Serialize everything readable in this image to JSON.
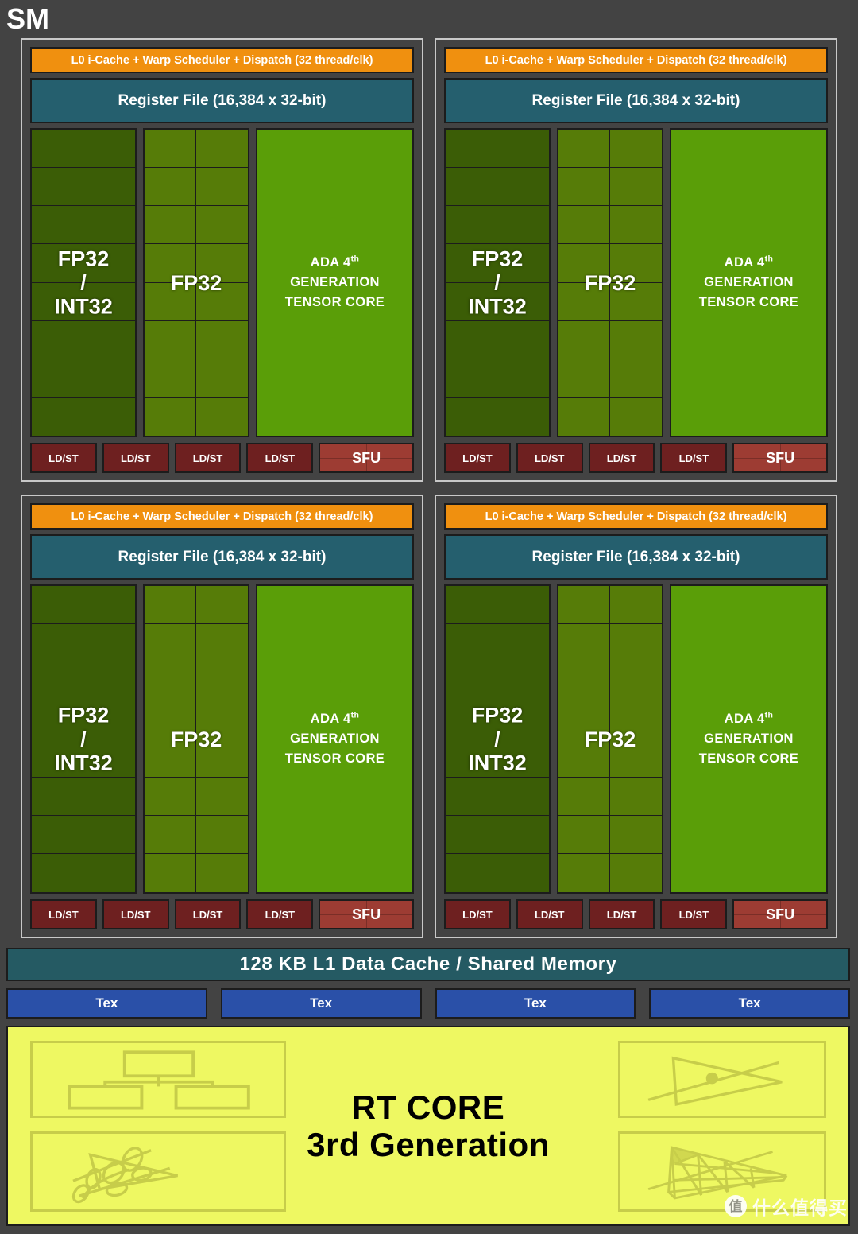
{
  "title": "SM",
  "scheduler_label": "L0 i-Cache + Warp Scheduler + Dispatch (32 thread/clk)",
  "register_file_label": "Register File (16,384 x 32-bit)",
  "core_labels": {
    "fp32_int32_line1": "FP32",
    "fp32_int32_line2": "/",
    "fp32_int32_line3": "INT32",
    "fp32": "FP32"
  },
  "tensor_core": {
    "line1_prefix": "ADA 4",
    "line1_sup": "th",
    "line2": "GENERATION",
    "line3": "TENSOR CORE"
  },
  "ldst_label": "LD/ST",
  "sfu_label": "SFU",
  "l1_cache_label": "128 KB L1 Data Cache / Shared Memory",
  "tex_label": "Tex",
  "rt_core": {
    "line1": "RT CORE",
    "line2": "3rd Generation"
  },
  "watermark": {
    "logo_char": "值",
    "text": "什么值得买"
  },
  "counts": {
    "quadrants": 4,
    "core_rows": 8,
    "core_cols": 2,
    "ldst_per_quadrant": 4,
    "sfu_per_quadrant": 1,
    "tex_units": 4
  },
  "colors": {
    "background": "#434343",
    "scheduler": "#f0900f",
    "register_file": "#255f6e",
    "fp32_int32": "#3b5d06",
    "fp32": "#567c08",
    "tensor_core": "#5a9e08",
    "ldst": "#6e2020",
    "sfu": "#9d3c33",
    "l1_cache": "#255a63",
    "tex": "#2a50a8",
    "rt_core": "#eef862",
    "rt_core_line": "#c7cd4a",
    "quadrant_border": "#c9c9c9"
  }
}
